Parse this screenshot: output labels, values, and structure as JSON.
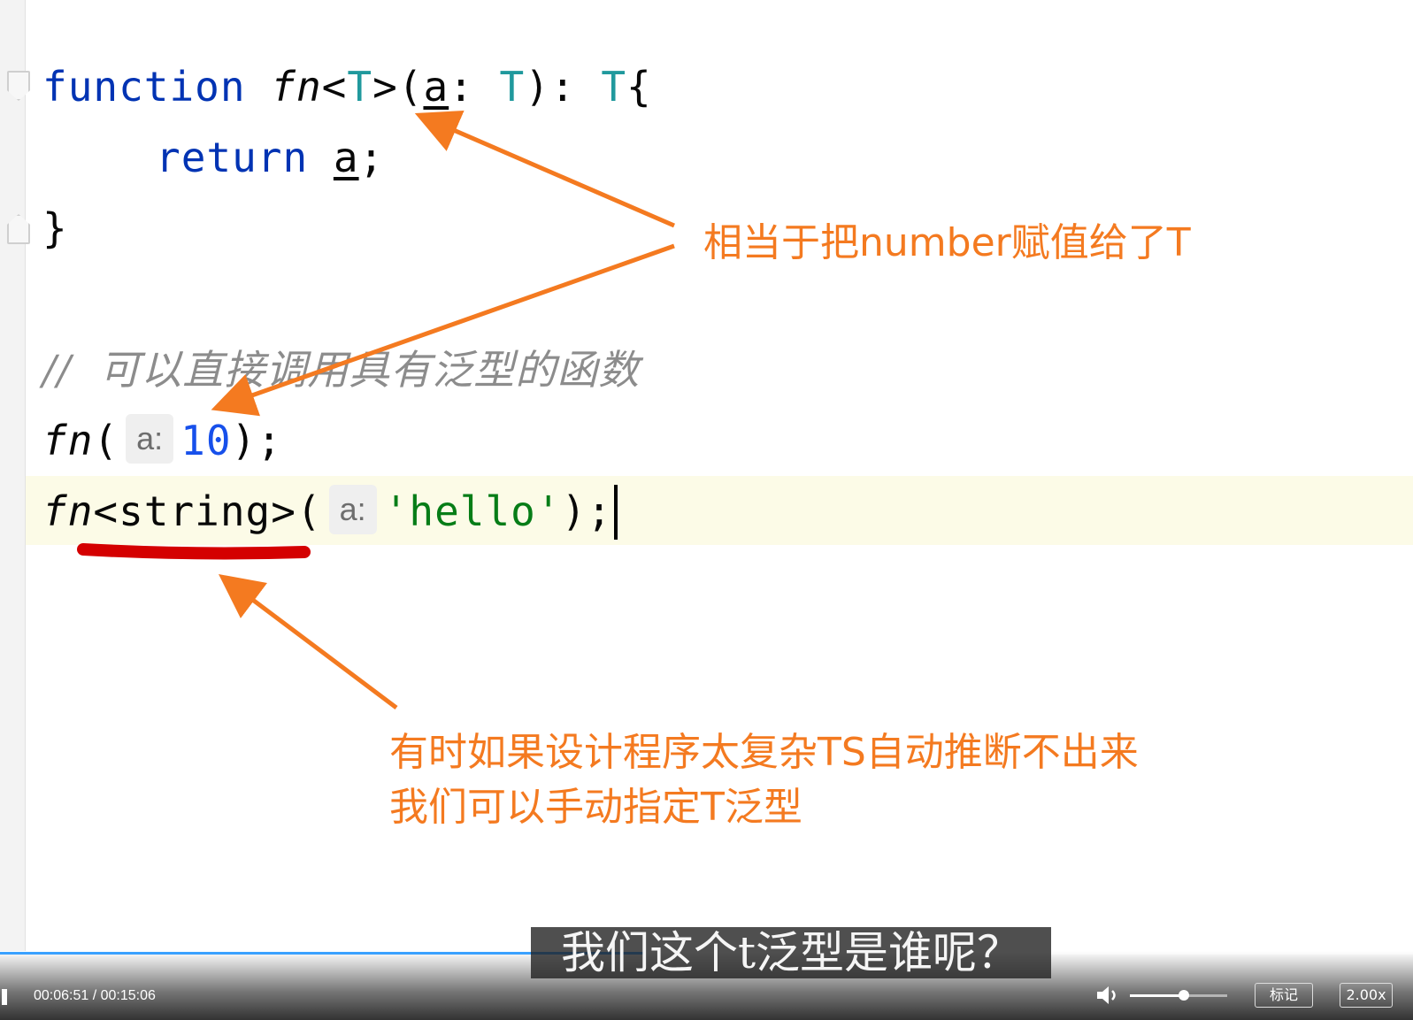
{
  "editor": {
    "lines": {
      "l1": {
        "kw": "function",
        "name": "fn",
        "lt": "<",
        "tparam": "T",
        "gt_paren": ">(",
        "param": "a",
        "colon": ": ",
        "type": "T",
        "close": "): ",
        "ret_type": "T",
        "brace": "{"
      },
      "l2": {
        "kw": "return",
        "space": " ",
        "param": "a",
        "semi": ";"
      },
      "l3": {
        "brace": "}"
      },
      "l4": {
        "comment": "//  可以直接调用具有泛型的函数"
      },
      "l5": {
        "name": "fn",
        "open": "(",
        "hint": "a:",
        "num": "10",
        "close": ");"
      },
      "l6": {
        "name": "fn",
        "generic": "<string>",
        "open": "(",
        "hint": "a:",
        "str": "'hello'",
        "close": ");"
      }
    }
  },
  "annotations": {
    "top": "相当于把number赋值给了T",
    "bottom_line1": "有时如果设计程序太复杂TS自动推断不出来",
    "bottom_line2": "我们可以手动指定T泛型",
    "color": "#f47a20",
    "underline_color": "#d40000"
  },
  "player": {
    "subtitle": "我们这个t泛型是谁呢？",
    "time": "00:06:51 / 00:15:06",
    "progress": 0.455,
    "volume": 0.55,
    "mark_label": "标记",
    "speed_label": "2.00x",
    "volume_icon": "speaker-icon",
    "accent": "#3aa1ff"
  }
}
